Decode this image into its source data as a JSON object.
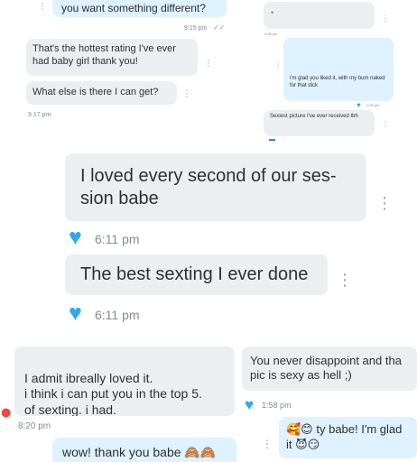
{
  "top_left": {
    "message_1": "you want something different?",
    "time_1": "9:15 pm",
    "message_2": "That's the hottest rating I've ever had baby girl thank you!",
    "message_3": "What else is there I can get?",
    "time_2": "9:17 pm"
  },
  "top_right": {
    "time_small": "3:08 pm",
    "message_1": "i'm glad you liked it, with my bum naked for that dick",
    "time_1": "1:53 pm",
    "message_2": "Sexiest picture I've ever received tbh"
  },
  "middle": {
    "message_1": "I loved every second of our ses-sion babe",
    "time_1": "6:11 pm",
    "message_2": "The best sexting I ever done",
    "time_2": "6:11 pm"
  },
  "bottom_left": {
    "message_1": "I admit ibreally loved it.\ni think i can put you in the top 5.\nof sexting. i had.",
    "time_1": "8:20 pm",
    "message_2": "wow! thank you babe",
    "emoji_2": "🙈🙈🙈"
  },
  "bottom_right": {
    "message_1": "You never disappoint and tha pic is sexy as hell ;)",
    "time_1": "1:58 pm",
    "message_2_prefix": "🥰😊",
    "message_2": "ty babe! I'm glad it",
    "message_2_suffix": "😈😏"
  },
  "icons": {
    "heart": "heart-icon",
    "more": "vertical-ellipsis-icon",
    "read": "double-check-icon"
  },
  "colors": {
    "sent_bubble": "#dff2ff",
    "received_bubble": "#eceff1",
    "heart": "#2ea7ee"
  }
}
